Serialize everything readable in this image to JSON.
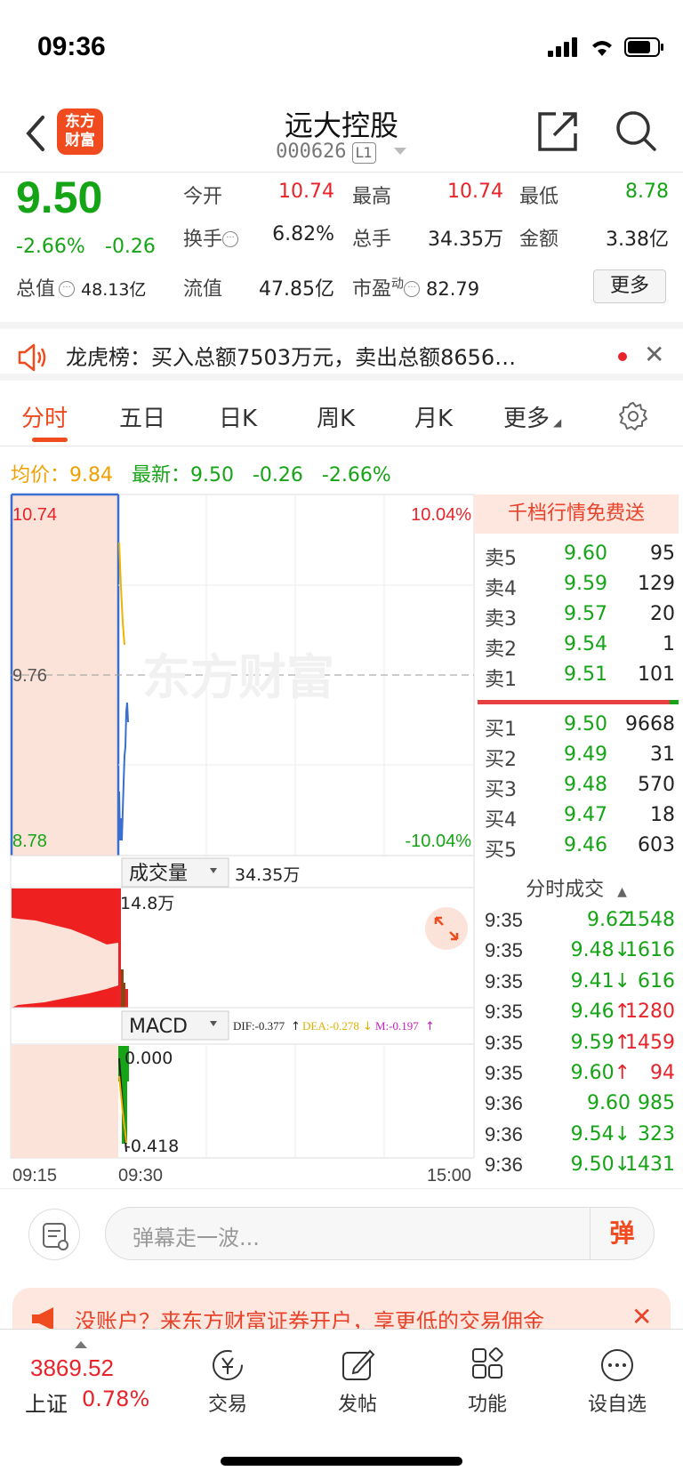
{
  "status_bar": {
    "time": "09:36"
  },
  "header": {
    "logo_text": "东方财富",
    "stock_name": "远大控股",
    "stock_code": "000626",
    "level_badge": "L1"
  },
  "quote": {
    "last_price": "9.50",
    "change_pct": "-2.66%",
    "change_abs": "-0.26",
    "open_label": "今开",
    "open": "10.74",
    "high_label": "最高",
    "high": "10.74",
    "low_label": "最低",
    "low": "8.78",
    "turnover_label": "换手",
    "turnover": "6.82%",
    "volume_label": "总手",
    "volume": "34.35万",
    "amount_label": "金额",
    "amount": "3.38亿",
    "total_mv_label": "总值",
    "total_mv": "48.13亿",
    "float_mv_label": "流值",
    "float_mv": "47.85亿",
    "pe_label": "市盈",
    "pe_sup": "动",
    "pe": "82.79",
    "more_label": "更多"
  },
  "notice": {
    "text": "龙虎榜：买入总额7503万元，卖出总额8656…"
  },
  "tabs": [
    "分时",
    "五日",
    "日K",
    "周K",
    "月K",
    "更多"
  ],
  "avg_row": {
    "avg_label": "均价：",
    "avg": "9.84",
    "latest_label": "最新：",
    "latest": "9.50",
    "latest_chg": "-0.26",
    "latest_pct": "-2.66%"
  },
  "chart": {
    "price_high": "10.74",
    "price_mid": "9.76",
    "price_low": "8.78",
    "pct_high": "10.04%",
    "pct_low": "-10.04%",
    "watermark": "东方财富",
    "volume_label": "成交量",
    "volume_total": "34.35万",
    "volume_max": "14.8万",
    "macd_label": "MACD",
    "dif": "DIF:-0.377",
    "dea": "DEA:-0.278",
    "m": "M:-0.197",
    "macd_top": "0.000",
    "macd_bottom": "-0.418",
    "time_start": "09:15",
    "time_open": "09:30",
    "time_end": "15:00"
  },
  "order_book": {
    "banner": "千档行情免费送",
    "asks": [
      {
        "label": "卖5",
        "price": "9.60",
        "vol": "95"
      },
      {
        "label": "卖4",
        "price": "9.59",
        "vol": "129"
      },
      {
        "label": "卖3",
        "price": "9.57",
        "vol": "20"
      },
      {
        "label": "卖2",
        "price": "9.54",
        "vol": "1"
      },
      {
        "label": "卖1",
        "price": "9.51",
        "vol": "101"
      }
    ],
    "bids": [
      {
        "label": "买1",
        "price": "9.50",
        "vol": "9668"
      },
      {
        "label": "买2",
        "price": "9.49",
        "vol": "31"
      },
      {
        "label": "买3",
        "price": "9.48",
        "vol": "570"
      },
      {
        "label": "买4",
        "price": "9.47",
        "vol": "18"
      },
      {
        "label": "买5",
        "price": "9.46",
        "vol": "603"
      }
    ]
  },
  "ticks": {
    "title": "分时成交",
    "rows": [
      {
        "time": "9:35",
        "price": "9.62",
        "vol": "1548",
        "dir": "",
        "price_color": "#15a415",
        "vol_color": "#15a415"
      },
      {
        "time": "9:35",
        "price": "9.48↓",
        "vol": "1616",
        "dir": "down",
        "price_color": "#15a415",
        "vol_color": "#15a415"
      },
      {
        "time": "9:35",
        "price": "9.41↓",
        "vol": "616",
        "dir": "down",
        "price_color": "#15a415",
        "vol_color": "#15a415"
      },
      {
        "time": "9:35",
        "price": "9.46↑",
        "vol": "1280",
        "dir": "up",
        "price_color": "#15a415",
        "vol_color": "#e8232a"
      },
      {
        "time": "9:35",
        "price": "9.59↑",
        "vol": "1459",
        "dir": "up",
        "price_color": "#15a415",
        "vol_color": "#e8232a"
      },
      {
        "time": "9:35",
        "price": "9.60↑",
        "vol": "94",
        "dir": "up",
        "price_color": "#15a415",
        "vol_color": "#e8232a"
      },
      {
        "time": "9:36",
        "price": "9.60",
        "vol": "985",
        "dir": "",
        "price_color": "#15a415",
        "vol_color": "#15a415"
      },
      {
        "time": "9:36",
        "price": "9.54↓",
        "vol": "323",
        "dir": "down",
        "price_color": "#15a415",
        "vol_color": "#15a415"
      },
      {
        "time": "9:36",
        "price": "9.50↓",
        "vol": "1431",
        "dir": "down",
        "price_color": "#15a415",
        "vol_color": "#15a415"
      }
    ]
  },
  "comment": {
    "placeholder": "弹幕走一波...",
    "danmu_label": "弹"
  },
  "promo": {
    "text": "没账户？来东方财富证券开户，享更低的交易佣金"
  },
  "bottom_nav": {
    "index_price": "3869.52",
    "index_name": "上证",
    "index_chg": "0.78%",
    "items": [
      {
        "label": "交易",
        "icon": "trade-icon"
      },
      {
        "label": "发帖",
        "icon": "post-icon"
      },
      {
        "label": "功能",
        "icon": "functions-icon"
      },
      {
        "label": "设自选",
        "icon": "add-watchlist-icon"
      }
    ]
  },
  "colors": {
    "up": "#e8232a",
    "down": "#15a415",
    "brand": "#f04b1e",
    "avg": "#f0a000"
  }
}
